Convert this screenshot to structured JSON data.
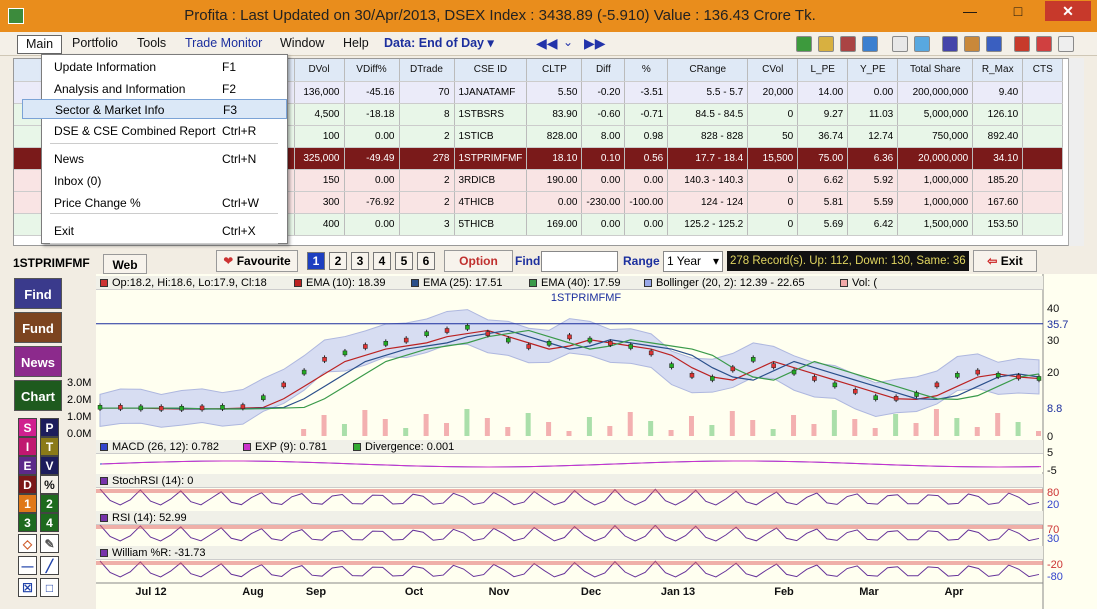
{
  "window": {
    "title": "Profita : Last Updated on 30/Apr/2013,  DSEX Index : 3438.89 (-5.910)  Value : 136.43 Crore Tk.",
    "min": "—",
    "max": "□",
    "close": "✕"
  },
  "menubar": {
    "items": [
      "Main",
      "Portfolio",
      "Tools",
      "Trade Monitor",
      "Window",
      "Help"
    ],
    "data_selector": "Data: End of Day"
  },
  "dropdown": {
    "items": [
      {
        "label": "Update Information",
        "key": "F1"
      },
      {
        "label": "Analysis and Information",
        "key": "F2"
      },
      {
        "label": "Sector & Market Info",
        "key": "F3"
      },
      {
        "label": "DSE & CSE Combined Report",
        "key": "Ctrl+R"
      },
      {
        "label": "News",
        "key": "Ctrl+N"
      },
      {
        "label": "Inbox (0)",
        "key": ""
      },
      {
        "label": "Price Change %",
        "key": "Ctrl+W"
      },
      {
        "label": "Exit",
        "key": "Ctrl+X"
      }
    ]
  },
  "grid": {
    "headers": [
      "DVol",
      "VDiff%",
      "DTrade",
      "CSE ID",
      "CLTP",
      "Diff",
      "%",
      "CRange",
      "CVol",
      "L_PE",
      "Y_PE",
      "Total Share",
      "R_Max",
      "CTS"
    ],
    "rows": [
      [
        "136,000",
        "-45.16",
        "70",
        "1JANATAMF",
        "5.50",
        "-0.20",
        "-3.51",
        "5.5 -  5.7",
        "20,000",
        "14.00",
        "0.00",
        "200,000,000",
        "9.40",
        ""
      ],
      [
        "4,500",
        "-18.18",
        "8",
        "1STBSRS",
        "83.90",
        "-0.60",
        "-0.71",
        "84.5 -  84.5",
        "0",
        "9.27",
        "11.03",
        "5,000,000",
        "126.10",
        ""
      ],
      [
        "100",
        "0.00",
        "2",
        "1STICB",
        "828.00",
        "8.00",
        "0.98",
        "828 -  828",
        "50",
        "36.74",
        "12.74",
        "750,000",
        "892.40",
        ""
      ],
      [
        "325,000",
        "-49.49",
        "278",
        "1STPRIMFMF",
        "18.10",
        "0.10",
        "0.56",
        "17.7 -  18.4",
        "15,500",
        "75.00",
        "6.36",
        "20,000,000",
        "34.10",
        ""
      ],
      [
        "150",
        "0.00",
        "2",
        "3RDICB",
        "190.00",
        "0.00",
        "0.00",
        "140.3 -  140.3",
        "0",
        "6.62",
        "5.92",
        "1,000,000",
        "185.20",
        ""
      ],
      [
        "300",
        "-76.92",
        "2",
        "4THICB",
        "0.00",
        "-230.00",
        "-100.00",
        "124 -  124",
        "0",
        "5.81",
        "5.59",
        "1,000,000",
        "167.60",
        ""
      ],
      [
        "400",
        "0.00",
        "3",
        "5THICB",
        "169.00",
        "0.00",
        "0.00",
        "125.2 -  125.2",
        "0",
        "5.69",
        "6.42",
        "1,500,000",
        "153.50",
        ""
      ]
    ]
  },
  "toolbar2": {
    "symbol": "1STPRIMFMF",
    "web": "Web",
    "favourite": "Favourite",
    "pages": [
      "1",
      "2",
      "3",
      "4",
      "5",
      "6"
    ],
    "option": "Option",
    "find": "Find",
    "range_label": "Range",
    "range_value": "1 Year",
    "records": "278 Record(s). Up: 112, Down: 130, Same: 36",
    "exit": "Exit"
  },
  "side": {
    "find": "Find",
    "fund": "Fund",
    "news": "News",
    "chart": "Chart",
    "grid": [
      [
        "S",
        "P"
      ],
      [
        "I",
        "T"
      ],
      [
        "E",
        "V"
      ],
      [
        "D",
        "%"
      ],
      [
        "1",
        "2"
      ],
      [
        "3",
        "4"
      ]
    ]
  },
  "chart_data": {
    "type": "line",
    "title": "1STPRIMFMF",
    "legend": {
      "ohlc": "Op:18.2, Hi:18.6, Lo:17.9, Cl:18",
      "ema10": "EMA (10): 18.39",
      "ema25": "EMA (25): 17.51",
      "ema40": "EMA (40): 17.59",
      "boll": "Bollinger (20, 2): 12.39 - 22.65",
      "vol": "Vol: ("
    },
    "price_axis": {
      "ticks": [
        "40",
        "35.7",
        "30",
        "20",
        "8.8",
        "0"
      ]
    },
    "volume_axis": {
      "ticks": [
        "3.0M",
        "2.0M",
        "1.0M",
        "0.0M"
      ]
    },
    "x_axis": {
      "ticks": [
        "Jul 12",
        "Aug",
        "Sep",
        "Oct",
        "Nov",
        "Dec",
        "Jan 13",
        "Feb",
        "Mar",
        "Apr"
      ]
    },
    "price": [
      9,
      9,
      8.8,
      8.7,
      8.7,
      8.8,
      9,
      9.2,
      12,
      16,
      20,
      24,
      26,
      28,
      29,
      30,
      32,
      33,
      34,
      32,
      30,
      28,
      29,
      31,
      30,
      29,
      28,
      26,
      22,
      19,
      18,
      21,
      24,
      22,
      20,
      18,
      16,
      14,
      12,
      11.8,
      13,
      16,
      19,
      20,
      19,
      18.5,
      18
    ],
    "macd": {
      "name": "MACD (26, 12): 0.782",
      "exp": "EXP (9): 0.781",
      "div": "Divergence: 0.001",
      "ticks": [
        "5",
        "-5"
      ]
    },
    "stochrsi": {
      "name": "StochRSI (14): 0",
      "ticks": [
        "80",
        "20"
      ]
    },
    "rsi": {
      "name": "RSI (14): 52.99",
      "ticks": [
        "70",
        "30"
      ]
    },
    "williams": {
      "name": "William %R: -31.73",
      "ticks": [
        "-20",
        "-80"
      ]
    }
  }
}
